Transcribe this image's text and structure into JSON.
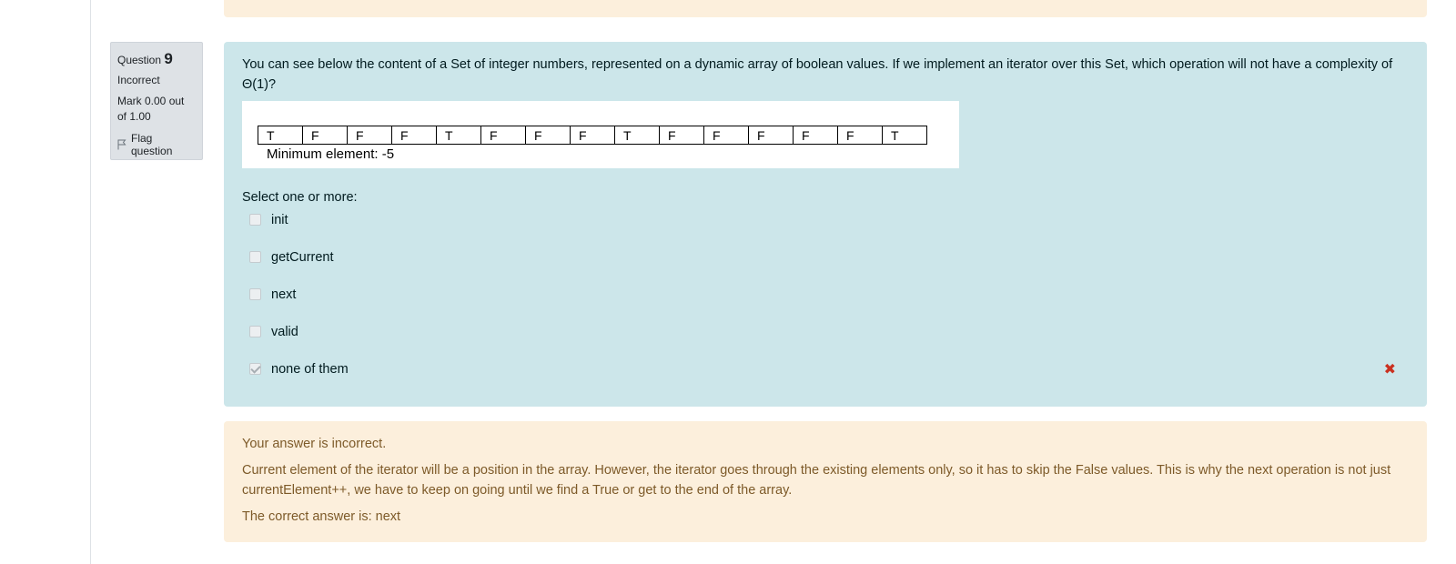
{
  "question_info": {
    "question_word": "Question",
    "number": "9",
    "state": "Incorrect",
    "grade": "Mark 0.00 out of 1.00",
    "flag_label": "Flag question"
  },
  "question": {
    "text": "You can see below the content of a Set of integer numbers, represented on a dynamic array of boolean values. If we implement an iterator over this Set, which operation will not have a complexity of Θ(1)?",
    "array_values": [
      "T",
      "F",
      "F",
      "F",
      "T",
      "F",
      "F",
      "F",
      "T",
      "F",
      "F",
      "F",
      "F",
      "F",
      "T"
    ],
    "minimum_element_label": "Minimum element:  -5",
    "prompt": "Select one or more:",
    "options": [
      {
        "label": "init",
        "checked": false
      },
      {
        "label": "getCurrent",
        "checked": false
      },
      {
        "label": "next",
        "checked": false
      },
      {
        "label": "valid",
        "checked": false
      },
      {
        "label": "none of them",
        "checked": true,
        "mark": "✖"
      }
    ]
  },
  "feedback": {
    "status": "Your answer is incorrect.",
    "general": "Current element of the iterator will be a position in the array. However, the iterator goes through the existing elements only, so it has to skip the False values. This is why the next operation is not just currentElement++, we have to keep on going until we find a True or get to the end of the array.",
    "right_answer": "The correct answer is: next"
  },
  "colors": {
    "formulation_bg": "#cce6ea",
    "outcome_bg": "#fcefdc",
    "info_bg": "#dee2e6",
    "incorrect_mark": "#ca3120"
  }
}
